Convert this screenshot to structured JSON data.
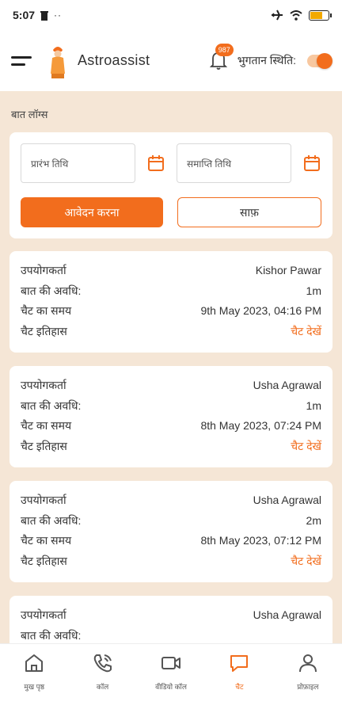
{
  "status_bar": {
    "time": "5:07",
    "dots": "··"
  },
  "app_bar": {
    "title": "Astroassist",
    "notification_count": "987",
    "payment_status_label": "भुगतान स्थिति:"
  },
  "page": {
    "section_title": "बात लॉग्स"
  },
  "filter": {
    "start_date_placeholder": "प्रारंभ तिथि",
    "end_date_placeholder": "समाप्ति तिथि",
    "apply_label": "आवेदन करना",
    "clear_label": "साफ़"
  },
  "labels": {
    "user": "उपयोगकर्ता",
    "duration": "बात की अवधि:",
    "chat_time": "चैट का समय",
    "chat_history": "चैट इतिहास",
    "view_chat": "चैट देखें"
  },
  "logs": [
    {
      "user": "Kishor Pawar",
      "duration": "1m",
      "time": "9th May 2023, 04:16 PM"
    },
    {
      "user": "Usha Agrawal",
      "duration": "1m",
      "time": "8th May 2023, 07:24 PM"
    },
    {
      "user": "Usha Agrawal",
      "duration": "2m",
      "time": "8th May 2023, 07:12 PM"
    },
    {
      "user": "Usha Agrawal",
      "duration": "",
      "time": ""
    }
  ],
  "bottom_nav": [
    {
      "label": "मुख पृष्ठ",
      "icon": "home-icon"
    },
    {
      "label": "कॉल",
      "icon": "phone-icon"
    },
    {
      "label": "वीडियो कॉल",
      "icon": "video-icon"
    },
    {
      "label": "चैट",
      "icon": "chat-icon",
      "active": true
    },
    {
      "label": "प्रोफ़ाइल",
      "icon": "profile-icon"
    }
  ],
  "colors": {
    "accent": "#f26d1d",
    "background": "#f5e6d6"
  }
}
